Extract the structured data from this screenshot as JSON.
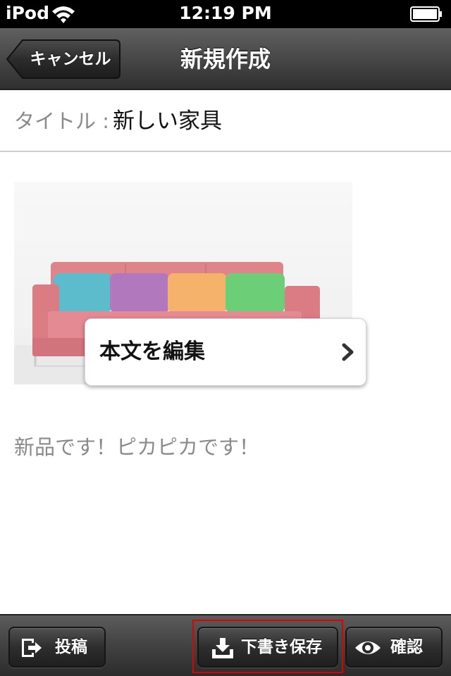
{
  "status_bar": {
    "carrier": "iPod",
    "time": "12:19 PM"
  },
  "nav": {
    "back_label": "キャンセル",
    "title": "新規作成"
  },
  "form": {
    "title_label": "タイトル :",
    "title_value": "新しい家具",
    "edit_body_label": "本文を編集",
    "body_text": "新品です！ピカピカです！"
  },
  "toolbar": {
    "post_label": "投稿",
    "draft_label": "下書き保存",
    "confirm_label": "確認"
  },
  "colors": {
    "highlight": "#e00000",
    "sofa": "#d96a72",
    "cushion_blue": "#3aaec0",
    "cushion_purple": "#a25bb0",
    "cushion_orange": "#f3a24a",
    "cushion_green": "#4cc45a"
  }
}
